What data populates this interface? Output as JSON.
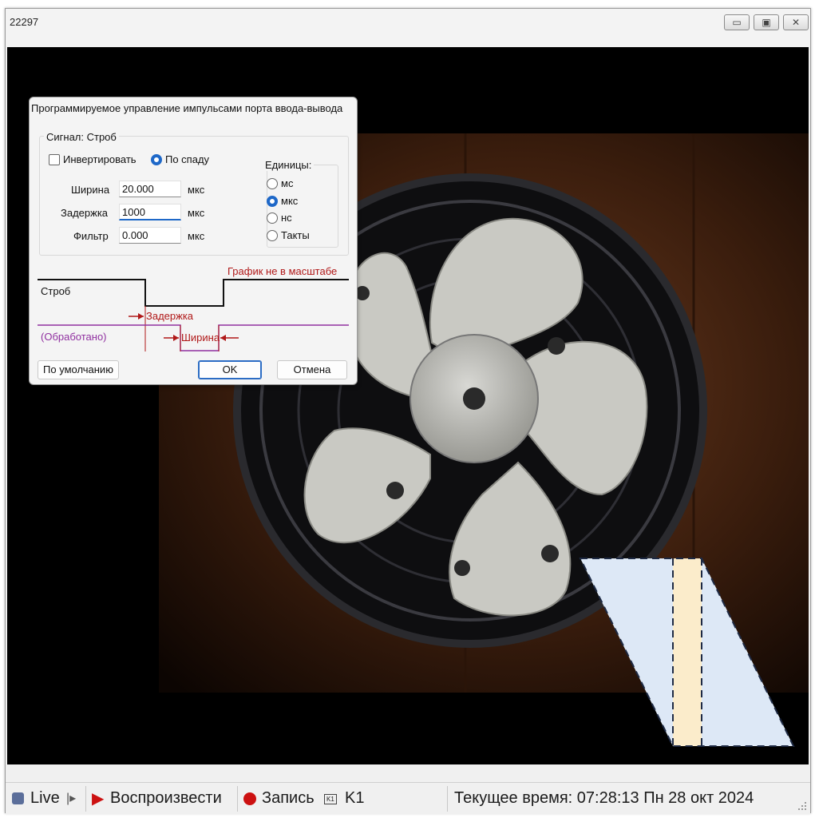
{
  "window": {
    "title": "22297"
  },
  "titlebar_buttons": {
    "minimize": "▭",
    "maximize": "▣",
    "close": "✕"
  },
  "dialog": {
    "title": "Программируемое управление импульсами порта ввода-вывода",
    "signal_group": "Сигнал: Строб",
    "invert": {
      "label": "Инвертировать",
      "checked": false
    },
    "edge": {
      "label": "По спаду",
      "checked": true
    },
    "fields": [
      {
        "label": "Ширина",
        "value": "20.000",
        "unit": "мкс"
      },
      {
        "label": "Задержка",
        "value": "1000",
        "unit": "мкс"
      },
      {
        "label": "Фильтр",
        "value": "0.000",
        "unit": "мкс"
      }
    ],
    "units": {
      "title": "Единицы:",
      "options": [
        "мс",
        "мкс",
        "нс",
        "Такты"
      ],
      "selected": "мкс"
    },
    "diagram": {
      "not_to_scale": "График не в масштабе",
      "strobe": "Строб",
      "delay": "Задержка",
      "processed": "(Обработано)",
      "width": "Ширина"
    },
    "buttons": {
      "defaults": "По умолчанию",
      "ok": "OK",
      "cancel": "Отмена"
    }
  },
  "statusbar": {
    "live": "Live",
    "play": "Воспроизвести",
    "record": "Запись",
    "channel_icon": "K1",
    "channel": "K1",
    "current_time": "Текущее время: 07:28:13  Пн 28 окт 2024"
  },
  "colors": {
    "accent": "#1e68c8",
    "play_red": "#cc1111",
    "diagram_red": "#b01818",
    "diagram_purple": "#9030a0",
    "overlay_blue": "#dde8f6",
    "overlay_cream": "#fbeccb"
  }
}
